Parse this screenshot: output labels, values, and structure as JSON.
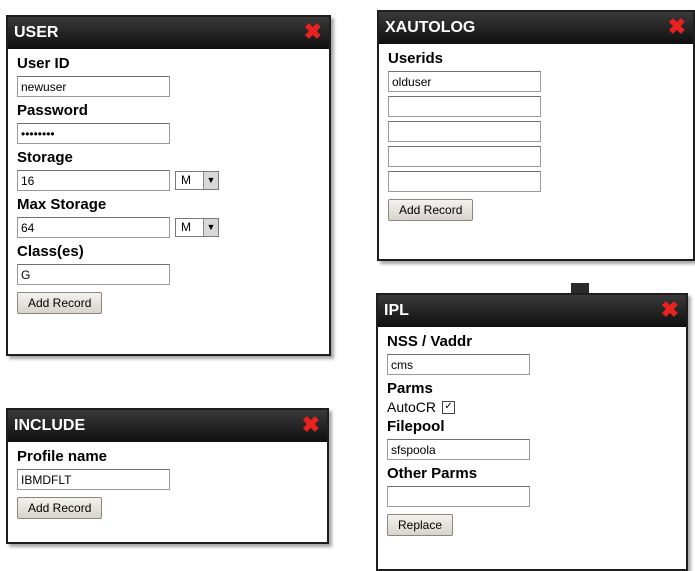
{
  "user_panel": {
    "title": "USER",
    "close_glyph": "✖",
    "userid_label": "User ID",
    "userid_value": "newuser",
    "password_label": "Password",
    "password_value": "••••••••",
    "storage_label": "Storage",
    "storage_value": "16",
    "storage_unit": "M",
    "maxstorage_label": "Max Storage",
    "maxstorage_value": "64",
    "maxstorage_unit": "M",
    "classes_label": "Class(es)",
    "classes_value": "G",
    "button": "Add Record"
  },
  "xautolog_panel": {
    "title": "XAUTOLOG",
    "close_glyph": "✖",
    "userids_label": "Userids",
    "userids": [
      "olduser",
      "",
      "",
      "",
      ""
    ],
    "button": "Add Record"
  },
  "include_panel": {
    "title": "INCLUDE",
    "close_glyph": "✖",
    "profile_label": "Profile name",
    "profile_value": "IBMDFLT",
    "button": "Add Record"
  },
  "ipl_panel": {
    "title": "IPL",
    "close_glyph": "✖",
    "nss_label": "NSS / Vaddr",
    "nss_value": "cms",
    "parms_label": "Parms",
    "autocr_label": "AutoCR",
    "autocr_checked": true,
    "autocr_mark": "✓",
    "filepool_label": "Filepool",
    "filepool_value": "sfspoola",
    "otherparms_label": "Other Parms",
    "otherparms_value": "",
    "button": "Replace"
  },
  "colors": {
    "titlebar": "#1a1a1a",
    "close": "#e8231f",
    "button_bg": "#e6e2da"
  },
  "icons": {
    "close": "close-icon",
    "dropdown": "chevron-down-icon",
    "checkbox": "checkbox-checked-icon"
  }
}
